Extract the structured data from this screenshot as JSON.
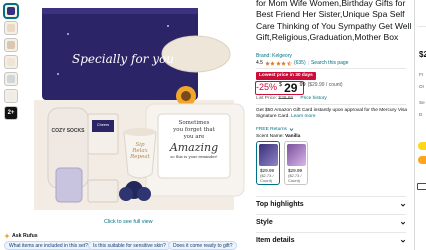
{
  "thumbnails": {
    "count_label": "2+"
  },
  "gallery": {
    "see_full_view": "Click to see full view",
    "box_script": "Specially for you",
    "card_line1": "Sometimes",
    "card_line2": "you forget that",
    "card_line3": "you are",
    "card_line4": "Amazing",
    "card_line5": "so this is your reminder!",
    "cup_text1": "Sip",
    "cup_text2": "Relax",
    "cup_text3": "Repeat",
    "socks_label": "COZY SOCKS",
    "heart_tag": "Cheers"
  },
  "rufus": {
    "title": "Ask Rufus",
    "chips": [
      "What items are included in this set?",
      "Is this suitable for sensitive skin?",
      "Does it come ready to gift?"
    ]
  },
  "product": {
    "title": "for Mom Wife Women,Birthday Gifts for Best Friend Her Sister,Unique Spa Self Care Thinking of You Sympathy Get Well Gift,Religious,Graduation,Mother Box",
    "brand": "Brand: Kelgeory",
    "rating": "4.5",
    "reviews": "(635)",
    "search_page": "Search this page",
    "deal_badge": "Lowest price in 30 days",
    "discount": "-25%",
    "currency": "$",
    "price_whole": "29",
    "price_fraction": "99",
    "per_count": "($29.99 / count)",
    "list_price_label": "List Price:",
    "list_price": "$39.99",
    "price_history": "Price history",
    "promo_text": "Get $50 Amazon Gift Card instantly upon approval for the Mercury Visa Signature Card.",
    "learn_more": "Learn more",
    "returns": "FREE Returns",
    "scent_label": "Scent Name:",
    "scent_value": "Vanilla",
    "swatches": [
      {
        "price": "$29.99",
        "unit": "($2.73 /",
        "unit2": "Count)"
      },
      {
        "price": "$29.99",
        "unit": "($2.73 /",
        "unit2": "Count)"
      }
    ]
  },
  "accordions": {
    "top": "Top highlights",
    "style": "Style",
    "details": "Item details"
  },
  "buybox": {
    "price_fragment": "$2",
    "line1": "Fr",
    "line2": "Or",
    "line3": "Se",
    "line4": "D"
  },
  "colors": {
    "accent": "#007185",
    "deal_red": "#cc0c39",
    "box_navy": "#2b2466",
    "add_to_cart": "#ffd814",
    "buy_now": "#ffa41c"
  }
}
